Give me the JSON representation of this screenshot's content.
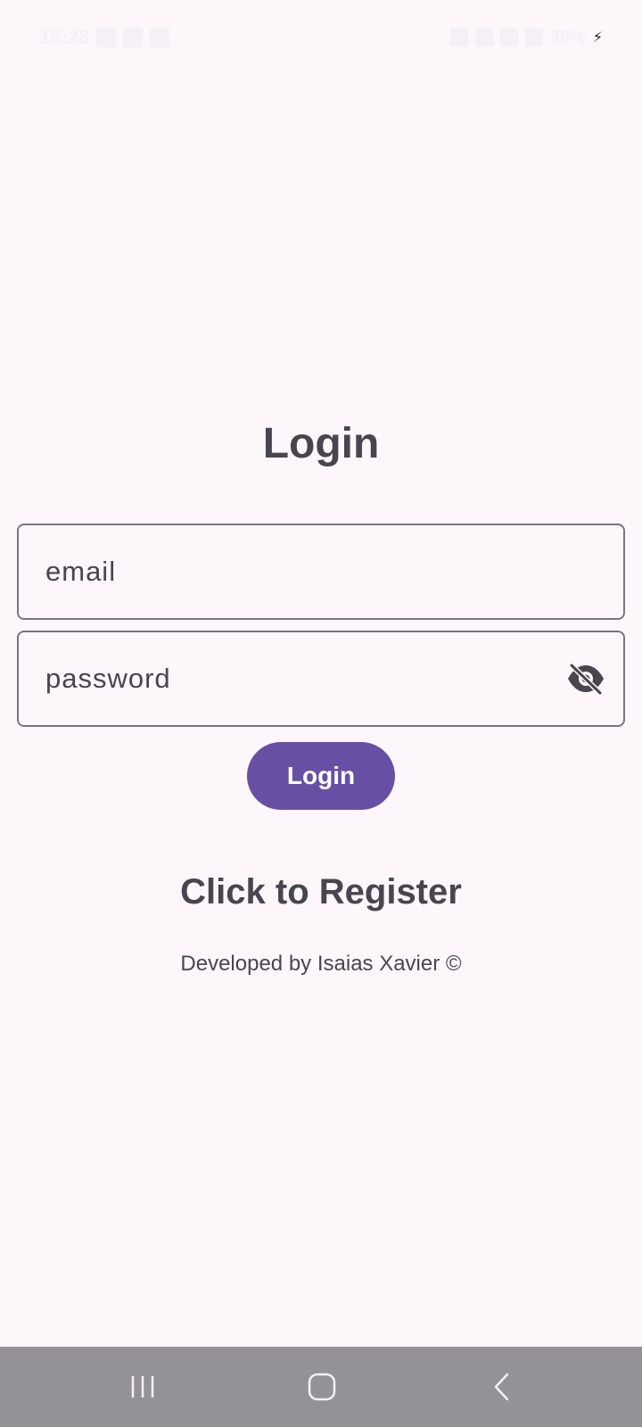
{
  "status_bar": {
    "time": "15:28",
    "left_icons": [
      "mail-icon",
      "settings-icon",
      "linkedin-icon"
    ],
    "right_icons": [
      "signal-icon",
      "mute-icon",
      "wifi-icon",
      "network-icon"
    ],
    "battery": "38%",
    "charging_icon": "bolt-icon"
  },
  "login_form": {
    "title": "Login",
    "email_placeholder": "email",
    "password_placeholder": "password",
    "password_toggle_icon": "eye-off-icon",
    "submit_label": "Login"
  },
  "register_link": "Click to Register",
  "footer": "Developed by Isaias Xavier ©",
  "nav_bar": {
    "buttons": [
      "recent-apps-icon",
      "home-icon",
      "back-icon"
    ]
  },
  "colors": {
    "background": "#fdf7fc",
    "primary": "#6750a4",
    "text": "#49454f",
    "outline": "#79747e",
    "nav_bar": "#959297"
  }
}
